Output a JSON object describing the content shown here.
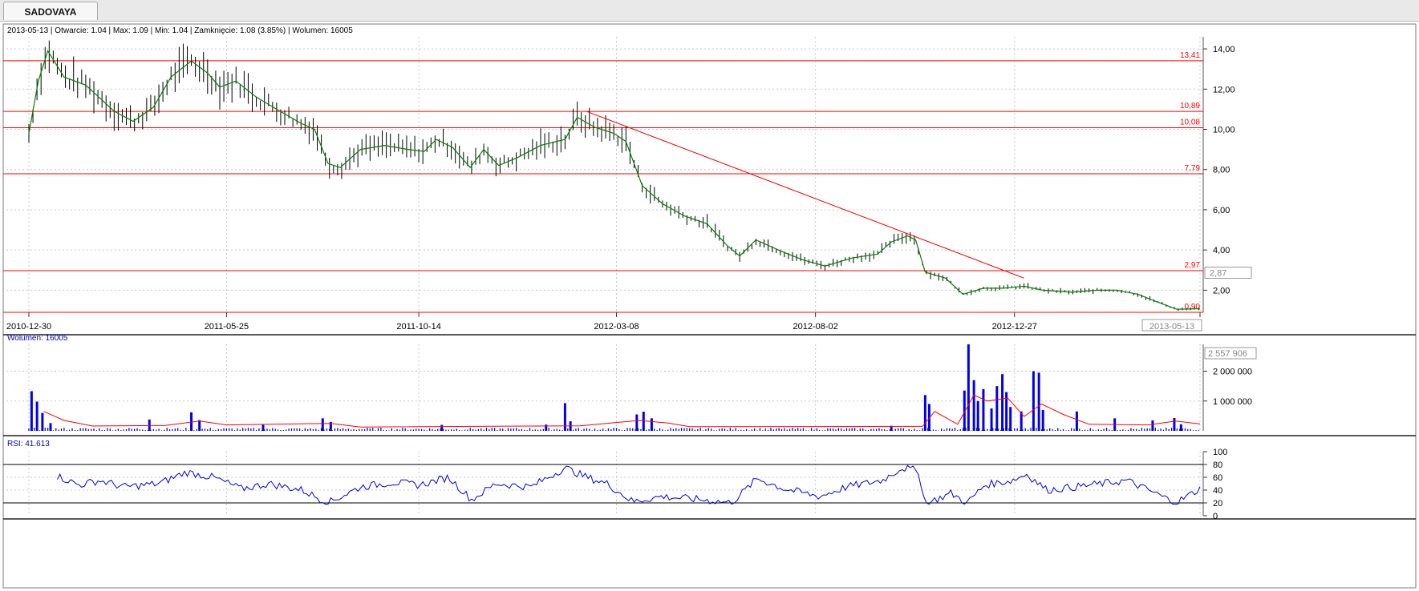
{
  "tab": {
    "label": "SADOVAYA"
  },
  "info": {
    "text": "2013-05-13 | Otwarcie: 1.04 | Max: 1.09 | Min: 1.04 | Zamknięcie: 1.08 (3.85%)  | Wolumen: 16005"
  },
  "volume_label": "Wolumen: 16005",
  "rsi_label": "RSI: 41.613",
  "colors": {
    "price": "#000000",
    "ma": "#008000",
    "levels": "#ff0000",
    "volume": "#0000ee",
    "volume_ma": "#ff0000",
    "rsi": "#0000ee",
    "grid": "#c8c8c8"
  },
  "chart_data": [
    {
      "type": "candlestick",
      "title": "SADOVAYA",
      "x_ticks": [
        "2010-12-30",
        "2011-05-25",
        "2011-10-14",
        "2012-03-08",
        "2012-08-02",
        "2012-12-27",
        "2013-05-13"
      ],
      "y_ticks": [
        "14,00",
        "12,00",
        "10,00",
        "8,00",
        "6,00",
        "4,00",
        "2,00"
      ],
      "ylim": [
        0.9,
        14.6
      ],
      "last_price_label": "2,87",
      "x_range": [
        "2010-12-30",
        "2013-05-13"
      ],
      "price_points": [
        [
          "2010-12-30",
          9.8
        ],
        [
          "2011-01-06",
          12.4
        ],
        [
          "2011-01-13",
          13.9
        ],
        [
          "2011-01-25",
          12.6
        ],
        [
          "2011-02-10",
          12.2
        ],
        [
          "2011-03-03",
          10.9
        ],
        [
          "2011-03-17",
          10.4
        ],
        [
          "2011-04-01",
          11.1
        ],
        [
          "2011-04-14",
          12.6
        ],
        [
          "2011-04-29",
          13.4
        ],
        [
          "2011-05-11",
          12.8
        ],
        [
          "2011-05-20",
          12.1
        ],
        [
          "2011-06-01",
          12.4
        ],
        [
          "2011-06-16",
          11.6
        ],
        [
          "2011-07-01",
          11.0
        ],
        [
          "2011-07-19",
          10.3
        ],
        [
          "2011-07-29",
          10.0
        ],
        [
          "2011-08-08",
          8.3
        ],
        [
          "2011-08-17",
          8.1
        ],
        [
          "2011-09-01",
          9.0
        ],
        [
          "2011-09-19",
          9.2
        ],
        [
          "2011-10-06",
          9.0
        ],
        [
          "2011-10-18",
          8.9
        ],
        [
          "2011-10-27",
          9.5
        ],
        [
          "2011-11-08",
          9.1
        ],
        [
          "2011-11-21",
          8.1
        ],
        [
          "2011-12-01",
          9.0
        ],
        [
          "2011-12-12",
          8.2
        ],
        [
          "2011-12-26",
          8.6
        ],
        [
          "2012-01-12",
          9.2
        ],
        [
          "2012-01-30",
          9.5
        ],
        [
          "2012-02-08",
          10.6
        ],
        [
          "2012-02-21",
          10.1
        ],
        [
          "2012-03-06",
          9.8
        ],
        [
          "2012-03-15",
          9.4
        ],
        [
          "2012-03-27",
          7.2
        ],
        [
          "2012-04-11",
          6.3
        ],
        [
          "2012-04-27",
          5.7
        ],
        [
          "2012-05-14",
          5.3
        ],
        [
          "2012-05-29",
          4.2
        ],
        [
          "2012-06-07",
          3.7
        ],
        [
          "2012-06-19",
          4.5
        ],
        [
          "2012-07-09",
          3.9
        ],
        [
          "2012-07-24",
          3.5
        ],
        [
          "2012-08-09",
          3.2
        ],
        [
          "2012-08-29",
          3.6
        ],
        [
          "2012-09-17",
          3.8
        ],
        [
          "2012-09-27",
          4.4
        ],
        [
          "2012-10-09",
          4.7
        ],
        [
          "2012-10-15",
          4.5
        ],
        [
          "2012-10-22",
          2.9
        ],
        [
          "2012-11-06",
          2.6
        ],
        [
          "2012-11-19",
          1.8
        ],
        [
          "2012-12-04",
          2.1
        ],
        [
          "2012-12-19",
          2.1
        ],
        [
          "2013-01-03",
          2.2
        ],
        [
          "2013-01-17",
          2.0
        ],
        [
          "2013-02-07",
          1.9
        ],
        [
          "2013-02-26",
          2.0
        ],
        [
          "2013-03-13",
          2.0
        ],
        [
          "2013-03-28",
          1.8
        ],
        [
          "2013-04-12",
          1.4
        ],
        [
          "2013-04-26",
          1.05
        ],
        [
          "2013-05-13",
          1.08
        ]
      ],
      "levels": [
        {
          "value": 13.41,
          "label": "13,41"
        },
        {
          "value": 10.89,
          "label": "10,89"
        },
        {
          "value": 10.08,
          "label": "10,08"
        },
        {
          "value": 7.79,
          "label": "7,79"
        },
        {
          "value": 2.97,
          "label": "2,97"
        },
        {
          "value": 0.9,
          "label": "0,90"
        }
      ],
      "trendline": [
        [
          "2012-02-15",
          10.89
        ],
        [
          "2013-01-03",
          2.6
        ]
      ]
    },
    {
      "type": "bar",
      "title": "Wolumen",
      "y_ticks": [
        "2 000 000",
        "1 000 000"
      ],
      "ylim": [
        0,
        2900000
      ],
      "last_volume_label": "2 557 906",
      "spikes": [
        [
          "2011-01-01",
          1330000
        ],
        [
          "2011-01-05",
          980000
        ],
        [
          "2011-01-09",
          600000
        ],
        [
          "2011-01-15",
          260000
        ],
        [
          "2011-03-29",
          380000
        ],
        [
          "2011-04-29",
          620000
        ],
        [
          "2011-05-05",
          360000
        ],
        [
          "2011-06-21",
          200000
        ],
        [
          "2011-08-04",
          420000
        ],
        [
          "2011-08-10",
          300000
        ],
        [
          "2011-10-31",
          200000
        ],
        [
          "2012-01-16",
          210000
        ],
        [
          "2012-01-30",
          930000
        ],
        [
          "2012-02-03",
          320000
        ],
        [
          "2012-03-23",
          550000
        ],
        [
          "2012-03-28",
          640000
        ],
        [
          "2012-04-03",
          420000
        ],
        [
          "2012-09-27",
          170000
        ],
        [
          "2012-10-22",
          1200000
        ],
        [
          "2012-10-25",
          900000
        ],
        [
          "2012-11-20",
          1350000
        ],
        [
          "2012-11-23",
          2900000
        ],
        [
          "2012-11-27",
          1700000
        ],
        [
          "2012-11-30",
          1000000
        ],
        [
          "2012-12-04",
          1400000
        ],
        [
          "2012-12-10",
          750000
        ],
        [
          "2012-12-14",
          1500000
        ],
        [
          "2012-12-18",
          1900000
        ],
        [
          "2012-12-21",
          1300000
        ],
        [
          "2012-12-24",
          800000
        ],
        [
          "2013-01-01",
          650000
        ],
        [
          "2013-01-10",
          2000000
        ],
        [
          "2013-01-14",
          1950000
        ],
        [
          "2013-01-17",
          700000
        ],
        [
          "2013-02-11",
          650000
        ],
        [
          "2013-03-11",
          420000
        ],
        [
          "2013-04-08",
          350000
        ],
        [
          "2013-04-24",
          430000
        ],
        [
          "2013-04-29",
          220000
        ]
      ],
      "ma_points": [
        [
          "2011-01-10",
          650000
        ],
        [
          "2011-01-25",
          350000
        ],
        [
          "2011-02-15",
          160000
        ],
        [
          "2011-04-10",
          180000
        ],
        [
          "2011-05-05",
          330000
        ],
        [
          "2011-05-25",
          200000
        ],
        [
          "2011-08-10",
          250000
        ],
        [
          "2011-09-01",
          130000
        ],
        [
          "2012-02-10",
          170000
        ],
        [
          "2012-03-25",
          350000
        ],
        [
          "2012-04-15",
          260000
        ],
        [
          "2012-05-01",
          140000
        ],
        [
          "2012-10-20",
          150000
        ],
        [
          "2012-10-29",
          650000
        ],
        [
          "2012-11-15",
          220000
        ],
        [
          "2012-11-27",
          1200000
        ],
        [
          "2012-12-07",
          1000000
        ],
        [
          "2012-12-22",
          1100000
        ],
        [
          "2013-01-03",
          480000
        ],
        [
          "2013-01-16",
          900000
        ],
        [
          "2013-02-01",
          550000
        ],
        [
          "2013-02-20",
          220000
        ],
        [
          "2013-04-05",
          200000
        ],
        [
          "2013-04-25",
          330000
        ],
        [
          "2013-05-13",
          230000
        ]
      ]
    },
    {
      "type": "line",
      "title": "RSI",
      "y_ticks": [
        "100",
        "80",
        "60",
        "40",
        "20",
        "0"
      ],
      "ylim": [
        0,
        100
      ],
      "bands": [
        80,
        20
      ],
      "series": [
        {
          "values": [
            [
              "2011-01-20",
              62
            ],
            [
              "2011-02-05",
              48
            ],
            [
              "2011-02-20",
              55
            ],
            [
              "2011-03-10",
              45
            ],
            [
              "2011-04-05",
              50
            ],
            [
              "2011-04-25",
              68
            ],
            [
              "2011-05-15",
              60
            ],
            [
              "2011-06-05",
              42
            ],
            [
              "2011-06-25",
              50
            ],
            [
              "2011-07-20",
              40
            ],
            [
              "2011-08-08",
              20
            ],
            [
              "2011-09-01",
              45
            ],
            [
              "2011-09-25",
              52
            ],
            [
              "2011-10-15",
              48
            ],
            [
              "2011-11-05",
              60
            ],
            [
              "2011-11-22",
              25
            ],
            [
              "2011-12-10",
              50
            ],
            [
              "2012-01-05",
              45
            ],
            [
              "2012-01-30",
              75
            ],
            [
              "2012-02-15",
              60
            ],
            [
              "2012-03-01",
              50
            ],
            [
              "2012-03-20",
              22
            ],
            [
              "2012-04-10",
              30
            ],
            [
              "2012-05-10",
              25
            ],
            [
              "2012-06-01",
              20
            ],
            [
              "2012-06-20",
              58
            ],
            [
              "2012-07-10",
              42
            ],
            [
              "2012-08-05",
              30
            ],
            [
              "2012-08-25",
              45
            ],
            [
              "2012-09-20",
              55
            ],
            [
              "2012-10-05",
              75
            ],
            [
              "2012-10-17",
              70
            ],
            [
              "2012-10-22",
              18
            ],
            [
              "2012-11-10",
              35
            ],
            [
              "2012-11-22",
              20
            ],
            [
              "2012-12-05",
              48
            ],
            [
              "2012-12-25",
              55
            ],
            [
              "2013-01-05",
              65
            ],
            [
              "2013-01-20",
              40
            ],
            [
              "2013-02-10",
              45
            ],
            [
              "2013-03-01",
              50
            ],
            [
              "2013-03-20",
              55
            ],
            [
              "2013-04-10",
              35
            ],
            [
              "2013-04-25",
              20
            ],
            [
              "2013-05-13",
              42
            ]
          ]
        }
      ]
    }
  ]
}
